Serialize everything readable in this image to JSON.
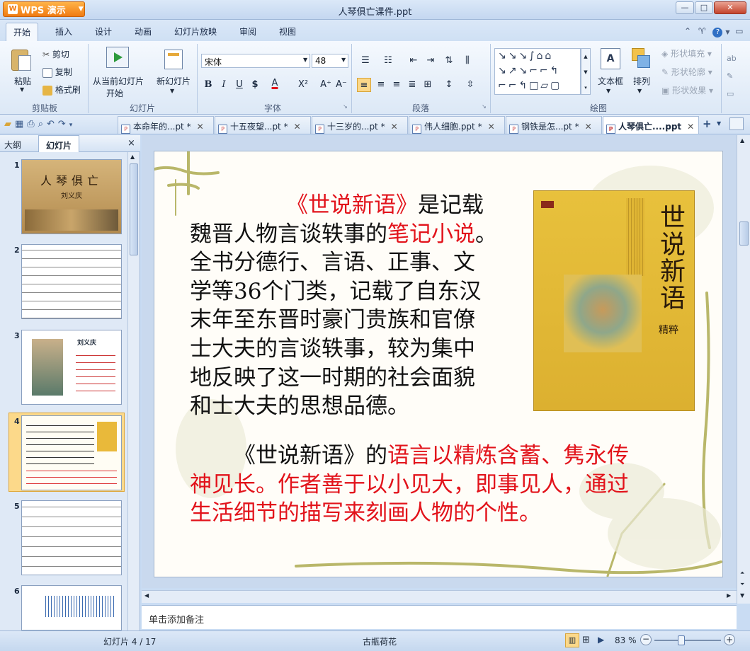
{
  "app": {
    "title": "WPS 演示",
    "window_title": "人琴俱亡课件.ppt",
    "window_buttons": [
      "—",
      "□",
      "✕"
    ]
  },
  "ribbon_tabs": [
    "开始",
    "插入",
    "设计",
    "动画",
    "幻灯片放映",
    "审阅",
    "视图"
  ],
  "ribbon": {
    "paste": "粘贴",
    "cut": "剪切",
    "copy": "复制",
    "format_painter": "格式刷",
    "clipboard_group": "剪贴板",
    "from_current_1": "从当前幻灯片",
    "from_current_2": "开始",
    "new_slide": "新幻灯片",
    "slides_group": "幻灯片",
    "font_name": "宋体",
    "font_size": "48",
    "font_group": "字体",
    "paragraph_group": "段落",
    "text_box": "文本框",
    "arrange": "排列",
    "shape_fill": "形状填充",
    "shape_outline": "形状轮廓",
    "shape_effect": "形状效果",
    "drawing_group": "绘图"
  },
  "doc_tabs": [
    {
      "label": "本命年的...pt *"
    },
    {
      "label": "十五夜望...pt *"
    },
    {
      "label": "十三岁的...pt *"
    },
    {
      "label": "伟人细胞.ppt *"
    },
    {
      "label": "钢铁是怎...pt *"
    },
    {
      "label": "人琴俱亡....ppt",
      "active": true
    }
  ],
  "left_panel": {
    "tabs": [
      "大纲",
      "幻灯片"
    ],
    "active_tab": "幻灯片",
    "close": "×"
  },
  "thumbnails": [
    {
      "num": "1",
      "title": "人琴俱亡",
      "subtitle": "刘义庆"
    },
    {
      "num": "2"
    },
    {
      "num": "3",
      "caption": "刘义庆"
    },
    {
      "num": "4",
      "selected": true
    },
    {
      "num": "5"
    },
    {
      "num": "6"
    }
  ],
  "slide": {
    "p1_book": "《世说新语》",
    "p1_a": "是记载",
    "p1_b": "魏晋人物言谈轶事的",
    "p1_red": "笔记小说",
    "p1_dot": "。",
    "p1_l3": "全书分德行、言语、正事、文",
    "p1_l4": "学等36个门类，记载了自东汉",
    "p1_l5": "末年至东晋时豪门贵族和官僚",
    "p1_l6": "士大夫的言谈轶事，较为集中",
    "p1_l7": "地反映了这一时期的社会面貌",
    "p1_l8": "和士大夫的思想品德。",
    "p2_black": "《世说新语》的",
    "p2_red1": "语言以精炼含蓄、隽永传",
    "p2_red2": "神见长。作者善于以小见大，即事见人，通过",
    "p2_red3": "生活细节的描写来刻画人物的个性。",
    "book_title": "世说新语",
    "book_sub": "精粹"
  },
  "notes_placeholder": "单击添加备注",
  "status": {
    "slide_counter": "幻灯片 4 / 17",
    "theme": "古瓶荷花",
    "zoom": "83 %",
    "zoom_level": 0.83
  },
  "colors": {
    "accent_red": "#e2131b",
    "ribbon_bg": "#dce8f6",
    "app_orange": "#f07b12"
  }
}
